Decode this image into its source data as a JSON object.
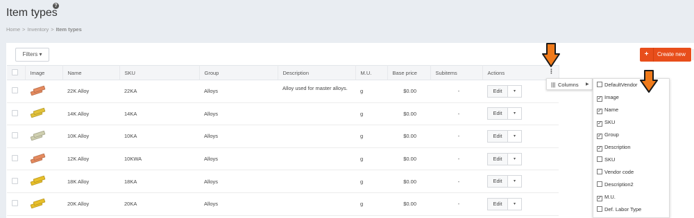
{
  "header": {
    "title": "Item types",
    "help_icon": "?",
    "breadcrumb": [
      "Home",
      "Inventory",
      "Item types"
    ],
    "breadcrumb_sep": ">"
  },
  "toolbar": {
    "filters_label": "Filters",
    "filters_caret": "▾",
    "create_plus": "+",
    "create_label": "Create new"
  },
  "table": {
    "columns": [
      "Image",
      "Name",
      "SKU",
      "Group",
      "Description",
      "M.U.",
      "Base price",
      "Subitems",
      "Actions"
    ],
    "rows": [
      {
        "name": "22K Alloy",
        "sku": "22KA",
        "group": "Alloys",
        "description": "Alloy used for master alloys.",
        "mu": "g",
        "price": "$0.00",
        "subitems": "-",
        "action": "Edit",
        "color": "#e58a5e"
      },
      {
        "name": "14K Alloy",
        "sku": "14KA",
        "group": "Alloys",
        "description": "",
        "mu": "g",
        "price": "$0.00",
        "subitems": "-",
        "action": "Edit",
        "color": "#e2c23a"
      },
      {
        "name": "10K Alloy",
        "sku": "10KA",
        "group": "Alloys",
        "description": "",
        "mu": "g",
        "price": "$0.00",
        "subitems": "-",
        "action": "Edit",
        "color": "#cfcfb0"
      },
      {
        "name": "12K Alloy",
        "sku": "10KWA",
        "group": "Alloys",
        "description": "",
        "mu": "g",
        "price": "$0.00",
        "subitems": "-",
        "action": "Edit",
        "color": "#e58a5e"
      },
      {
        "name": "18K Alloy",
        "sku": "18KA",
        "group": "Alloys",
        "description": "",
        "mu": "g",
        "price": "$0.00",
        "subitems": "-",
        "action": "Edit",
        "color": "#e8bf2a"
      },
      {
        "name": "20K Alloy",
        "sku": "20KA",
        "group": "Alloys",
        "description": "",
        "mu": "g",
        "price": "$0.00",
        "subitems": "-",
        "action": "Edit",
        "color": "#e8bf2a"
      }
    ]
  },
  "menu": {
    "kebab": "⋮",
    "columns_icon": "|||",
    "columns_label": "Columns",
    "columns_arrow": "▶",
    "options": [
      {
        "label": "DefaultVendor",
        "checked": false
      },
      {
        "label": "Image",
        "checked": true
      },
      {
        "label": "Name",
        "checked": true
      },
      {
        "label": "SKU",
        "checked": true
      },
      {
        "label": "Group",
        "checked": true
      },
      {
        "label": "Description",
        "checked": true
      },
      {
        "label": "SKU",
        "checked": false
      },
      {
        "label": "Vendor code",
        "checked": false
      },
      {
        "label": "Description2",
        "checked": false
      },
      {
        "label": "M.U.",
        "checked": true
      },
      {
        "label": "Def. Labor Type",
        "checked": false
      }
    ]
  },
  "annotation_color": "#f07a1a"
}
